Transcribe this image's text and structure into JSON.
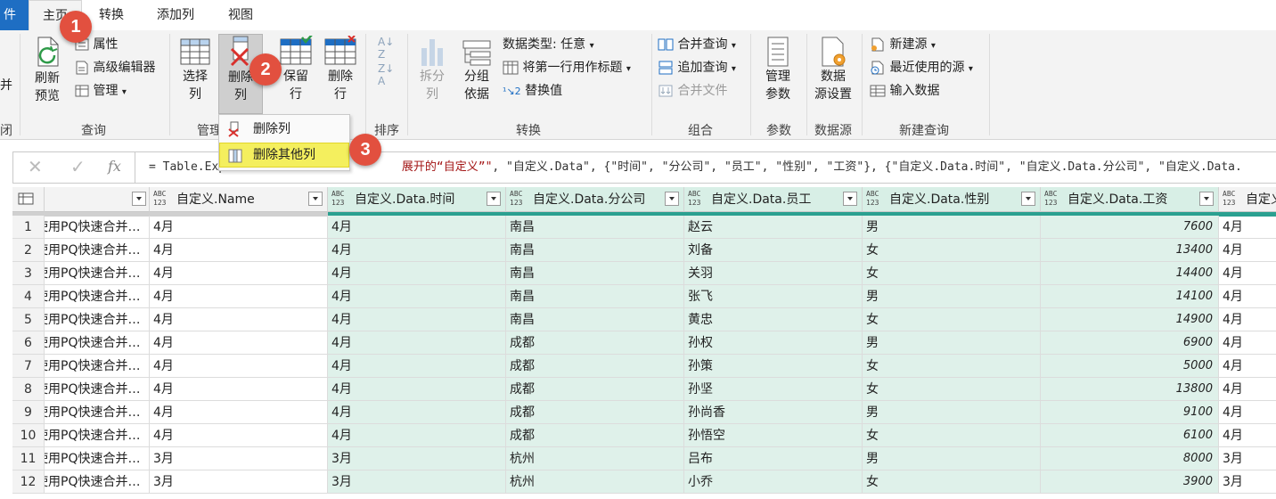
{
  "tabs": [
    "件",
    "主页",
    "转换",
    "添加列",
    "视图"
  ],
  "ribbon": {
    "left_partial": {
      "top": "并",
      "bottom": "闭"
    },
    "query": {
      "refresh_label": "刷新\n预览",
      "properties": "属性",
      "advanced_editor": "高级编辑器",
      "manage": "管理",
      "group": "查询"
    },
    "manage_cols": {
      "choose_cols": "选择\n列",
      "remove_cols": "删除\n列",
      "group": "管理"
    },
    "reduce_rows": {
      "keep_rows": "保留\n行",
      "remove_rows": "删除\n行"
    },
    "sort": {
      "group": "排序"
    },
    "transform": {
      "split": "拆分\n列",
      "group_by": "分组\n依据",
      "data_type": "数据类型: 任意",
      "first_row_header": "将第一行用作标题",
      "replace_values": "替换值",
      "group": "转换"
    },
    "combine": {
      "merge": "合并查询",
      "append": "追加查询",
      "combine_files": "合并文件",
      "group": "组合"
    },
    "params": {
      "manage": "管理\n参数",
      "group": "参数"
    },
    "datasource": {
      "settings": "数据\n源设置",
      "group": "数据源"
    },
    "newquery": {
      "new_source": "新建源",
      "recent": "最近使用的源",
      "enter_data": "输入数据",
      "group": "新建查询"
    }
  },
  "menu": {
    "remove_cols": "删除列",
    "remove_other": "删除其他列"
  },
  "badges": [
    "1",
    "2",
    "3"
  ],
  "formula": {
    "prefix": "= Table.Expa",
    "middle": "展开的“自定义”\"",
    "rest": ", \"自定义.Data\", {\"时间\", \"分公司\", \"员工\", \"性别\", \"工资\"}, {\"自定义.Data.时间\", \"自定义.Data.分公司\", \"自定义.Data.",
    "fx": "fx"
  },
  "columns": [
    {
      "name": "自定义.Name"
    },
    {
      "name": "自定义.Data.时间"
    },
    {
      "name": "自定义.Data.分公司"
    },
    {
      "name": "自定义.Data.员工"
    },
    {
      "name": "自定义.Data.性别"
    },
    {
      "name": "自定义.Data.工资"
    },
    {
      "name": "自定义"
    }
  ],
  "type_badge": {
    "line1": "ABC",
    "line2": "123"
  },
  "rows": [
    {
      "n": "1",
      "c0": "使用PQ快速合并…",
      "name": "4月",
      "time": "4月",
      "branch": "南昌",
      "emp": "赵云",
      "sex": "男",
      "salary": "7600",
      "last": "4月"
    },
    {
      "n": "2",
      "c0": "使用PQ快速合并…",
      "name": "4月",
      "time": "4月",
      "branch": "南昌",
      "emp": "刘备",
      "sex": "女",
      "salary": "13400",
      "last": "4月"
    },
    {
      "n": "3",
      "c0": "使用PQ快速合并…",
      "name": "4月",
      "time": "4月",
      "branch": "南昌",
      "emp": "关羽",
      "sex": "女",
      "salary": "14400",
      "last": "4月"
    },
    {
      "n": "4",
      "c0": "使用PQ快速合并…",
      "name": "4月",
      "time": "4月",
      "branch": "南昌",
      "emp": "张飞",
      "sex": "男",
      "salary": "14100",
      "last": "4月"
    },
    {
      "n": "5",
      "c0": "使用PQ快速合并…",
      "name": "4月",
      "time": "4月",
      "branch": "南昌",
      "emp": "黄忠",
      "sex": "女",
      "salary": "14900",
      "last": "4月"
    },
    {
      "n": "6",
      "c0": "使用PQ快速合并…",
      "name": "4月",
      "time": "4月",
      "branch": "成都",
      "emp": "孙权",
      "sex": "男",
      "salary": "6900",
      "last": "4月"
    },
    {
      "n": "7",
      "c0": "使用PQ快速合并…",
      "name": "4月",
      "time": "4月",
      "branch": "成都",
      "emp": "孙策",
      "sex": "女",
      "salary": "5000",
      "last": "4月"
    },
    {
      "n": "8",
      "c0": "使用PQ快速合并…",
      "name": "4月",
      "time": "4月",
      "branch": "成都",
      "emp": "孙坚",
      "sex": "女",
      "salary": "13800",
      "last": "4月"
    },
    {
      "n": "9",
      "c0": "使用PQ快速合并…",
      "name": "4月",
      "time": "4月",
      "branch": "成都",
      "emp": "孙尚香",
      "sex": "男",
      "salary": "9100",
      "last": "4月"
    },
    {
      "n": "10",
      "c0": "使用PQ快速合并…",
      "name": "4月",
      "time": "4月",
      "branch": "成都",
      "emp": "孙悟空",
      "sex": "女",
      "salary": "6100",
      "last": "4月"
    },
    {
      "n": "11",
      "c0": "使用PQ快速合并…",
      "name": "3月",
      "time": "3月",
      "branch": "杭州",
      "emp": "吕布",
      "sex": "男",
      "salary": "8000",
      "last": "3月"
    },
    {
      "n": "12",
      "c0": "使用PQ快速合并…",
      "name": "3月",
      "time": "3月",
      "branch": "杭州",
      "emp": "小乔",
      "sex": "女",
      "salary": "3900",
      "last": "3月"
    }
  ],
  "colors": {
    "accent": "#1e6ec3",
    "highlight": "#f4ef5e",
    "badge": "#e2503f",
    "selected_col": "#dff1ea",
    "teal": "#2aa090"
  }
}
